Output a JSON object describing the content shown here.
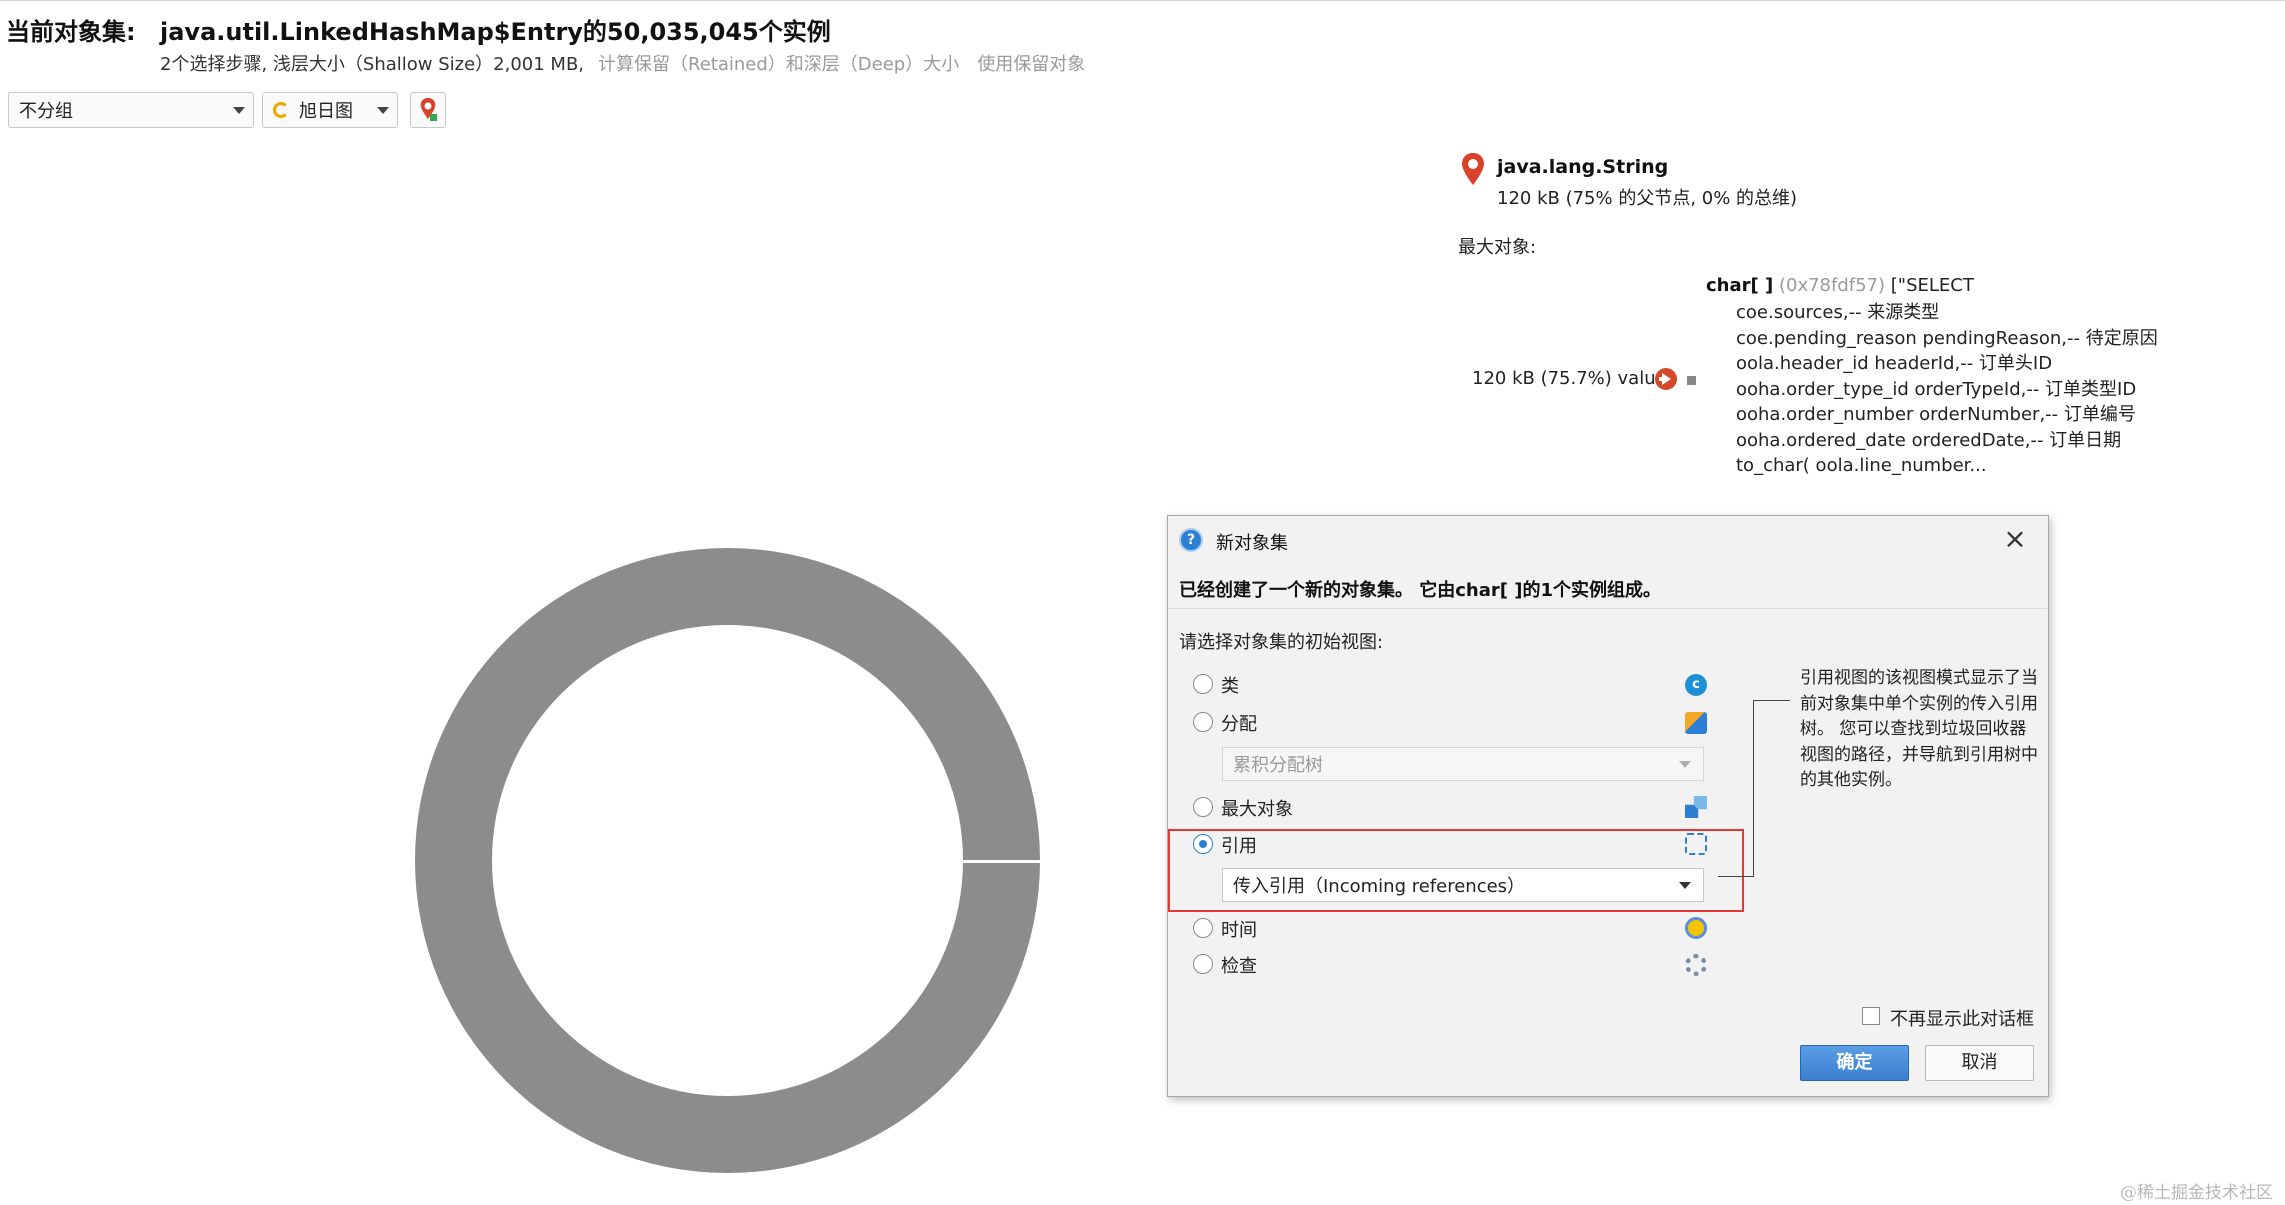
{
  "header": {
    "label": "当前对象集:",
    "title": "java.util.LinkedHashMap$Entry的50,035,045个实例",
    "subtitle": "2个选择步骤, 浅层大小（Shallow Size）2,001 MB,",
    "retained_link": "计算保留（Retained）和深层（Deep）大小",
    "use_retained_link": "使用保留对象"
  },
  "toolbar": {
    "grouping": "不分组",
    "view": "旭日图"
  },
  "info": {
    "class_name": "java.lang.String",
    "size_text": "120 kB (75% 的父节点, 0% 的总维)",
    "biggest_label": "最大对象:",
    "field_label": "120 kB (75.7%) value",
    "object_type": "char[ ]",
    "object_addr": "(0x78fdf57)",
    "object_preview_first": "[\"SELECT",
    "object_lines": [
      "coe.sources,-- 来源类型",
      "coe.pending_reason pendingReason,-- 待定原因",
      "oola.header_id headerId,-- 订单头ID",
      "ooha.order_type_id orderTypeId,-- 订单类型ID",
      "ooha.order_number orderNumber,-- 订单编号",
      "ooha.ordered_date orderedDate,-- 订单日期",
      "to_char( oola.line_number..."
    ]
  },
  "chart_data": {
    "type": "pie",
    "style": "donut",
    "slices": [
      {
        "label": "java.lang.String",
        "percent": 100
      }
    ],
    "color": "#8c8c8c"
  },
  "dialog": {
    "title": "新对象集",
    "message": "已经创建了一个新的对象集。 它由char[ ]的1个实例组成。",
    "prompt": "请选择对象集的初始视图:",
    "options": [
      {
        "label": "类",
        "icon": "class-icon",
        "selected": false
      },
      {
        "label": "分配",
        "icon": "allocation-icon",
        "selected": false
      },
      {
        "label": "最大对象",
        "icon": "biggest-objects-icon",
        "selected": false
      },
      {
        "label": "引用",
        "icon": "references-icon",
        "selected": true
      },
      {
        "label": "时间",
        "icon": "time-icon",
        "selected": false
      },
      {
        "label": "检查",
        "icon": "inspection-icon",
        "selected": false
      }
    ],
    "allocation_sub": "累积分配树",
    "references_sub": "传入引用（Incoming references）",
    "description": "引用视图的该视图模式显示了当前对象集中单个实例的传入引用树。 您可以查找到垃圾回收器视图的路径，并导航到引用树中的其他实例。",
    "dont_show": "不再显示此对话框",
    "ok": "确定",
    "cancel": "取消"
  },
  "watermark": "@稀土掘金技术社区"
}
